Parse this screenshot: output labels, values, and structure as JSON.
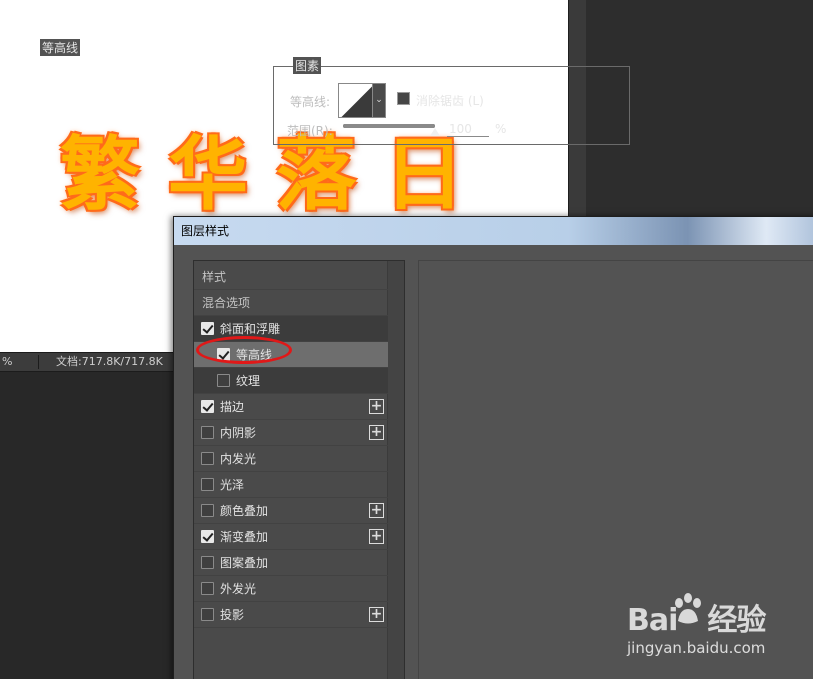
{
  "canvas": {
    "art_text": "繁华落日",
    "text_color": "#ffb300",
    "stroke_color": "#ff6a1a"
  },
  "status": {
    "zoom": "%",
    "doc_info": "文档:717.8K/717.8K"
  },
  "dialog": {
    "title": "图层样式",
    "styles_list": [
      {
        "label": "样式",
        "checkbox": null,
        "plus": false,
        "kind": "header"
      },
      {
        "label": "混合选项",
        "checkbox": null,
        "plus": false,
        "kind": "header"
      },
      {
        "label": "斜面和浮雕",
        "checkbox": true,
        "plus": false,
        "kind": "parent"
      },
      {
        "label": "等高线",
        "checkbox": true,
        "plus": false,
        "kind": "selected"
      },
      {
        "label": "纹理",
        "checkbox": false,
        "plus": false,
        "kind": "sub"
      },
      {
        "label": "描边",
        "checkbox": true,
        "plus": true,
        "kind": "item"
      },
      {
        "label": "内阴影",
        "checkbox": false,
        "plus": true,
        "kind": "item"
      },
      {
        "label": "内发光",
        "checkbox": false,
        "plus": false,
        "kind": "item"
      },
      {
        "label": "光泽",
        "checkbox": false,
        "plus": false,
        "kind": "item"
      },
      {
        "label": "颜色叠加",
        "checkbox": false,
        "plus": true,
        "kind": "item"
      },
      {
        "label": "渐变叠加",
        "checkbox": true,
        "plus": true,
        "kind": "item"
      },
      {
        "label": "图案叠加",
        "checkbox": false,
        "plus": false,
        "kind": "item"
      },
      {
        "label": "外发光",
        "checkbox": false,
        "plus": false,
        "kind": "item"
      },
      {
        "label": "投影",
        "checkbox": false,
        "plus": true,
        "kind": "item"
      }
    ],
    "panel": {
      "section_title": "等高线",
      "group_title": "图素",
      "contour_label": "等高线:",
      "antialias_label": "消除锯齿 (L)",
      "antialias_checked": false,
      "range_label": "范围(R):",
      "range_value": "100",
      "range_percent": 100,
      "range_unit": "%"
    }
  },
  "watermark": {
    "logo": "Bai",
    "logo_suffix": "经验",
    "url": "jingyan.baidu.com"
  },
  "annotation_color": "#e01818"
}
